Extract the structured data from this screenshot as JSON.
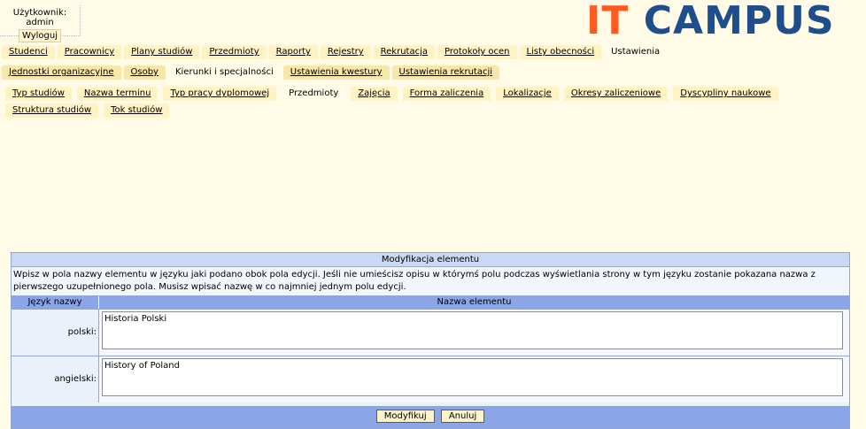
{
  "header": {
    "user_line": "Użytkownik: admin",
    "logout_label": "Wyloguj",
    "logo_it": "IT",
    "logo_campus": "CAMPUS"
  },
  "nav_main": [
    {
      "label": "Studenci",
      "active": false
    },
    {
      "label": "Pracownicy",
      "active": false
    },
    {
      "label": "Plany studiów",
      "active": false
    },
    {
      "label": "Przedmioty",
      "active": false
    },
    {
      "label": "Raporty",
      "active": false
    },
    {
      "label": "Rejestry",
      "active": false
    },
    {
      "label": "Rekrutacja",
      "active": false
    },
    {
      "label": "Protokoły ocen",
      "active": false
    },
    {
      "label": "Listy obecności",
      "active": false
    },
    {
      "label": "Ustawienia",
      "active": true
    }
  ],
  "nav_sub": [
    {
      "label": "Jednostki organizacyjne",
      "active": false
    },
    {
      "label": "Osoby",
      "active": false
    },
    {
      "label": "Kierunki i specjalności",
      "active": true
    },
    {
      "label": "Ustawienia kwestury",
      "active": false
    },
    {
      "label": "Ustawienia rekrutacji",
      "active": false
    }
  ],
  "nav_third": [
    {
      "label": "Typ studiów",
      "active": false
    },
    {
      "label": "Nazwa terminu",
      "active": false
    },
    {
      "label": "Typ pracy dyplomowej",
      "active": false
    },
    {
      "label": "Przedmioty",
      "active": true
    },
    {
      "label": "Zajęcia",
      "active": false
    },
    {
      "label": "Forma zaliczenia",
      "active": false
    },
    {
      "label": "Lokalizacje",
      "active": false
    },
    {
      "label": "Okresy zaliczeniowe",
      "active": false
    },
    {
      "label": "Dyscypliny naukowe",
      "active": false
    },
    {
      "label": "Struktura studiów",
      "active": false
    },
    {
      "label": "Tok studiów",
      "active": false
    }
  ],
  "panel": {
    "title": "Modyfikacja elementu",
    "description": "Wpisz w pola nazwy elementu w języku jaki podano obok pola edycji. Jeśli nie umieścisz opisu w którymś polu podczas wyświetlania strony w tym języku zostanie pokazana nazwa z pierwszego uzupełnionego pola. Musisz wpisać nazwę w co najmniej jednym polu edycji.",
    "col_language": "Język nazwy",
    "col_name": "Nazwa elementu",
    "rows": [
      {
        "language": "polski:",
        "value": "Historia Polski"
      },
      {
        "language": "angielski:",
        "value": "History of Poland"
      }
    ],
    "modify_label": "Modyfikuj",
    "cancel_label": "Anuluj"
  },
  "colors": {
    "logo_it": "#ff5a1f",
    "logo_campus": "#1f4e8c",
    "page_bg": "#fffbe6",
    "panel_header": "#8aa6e6"
  }
}
